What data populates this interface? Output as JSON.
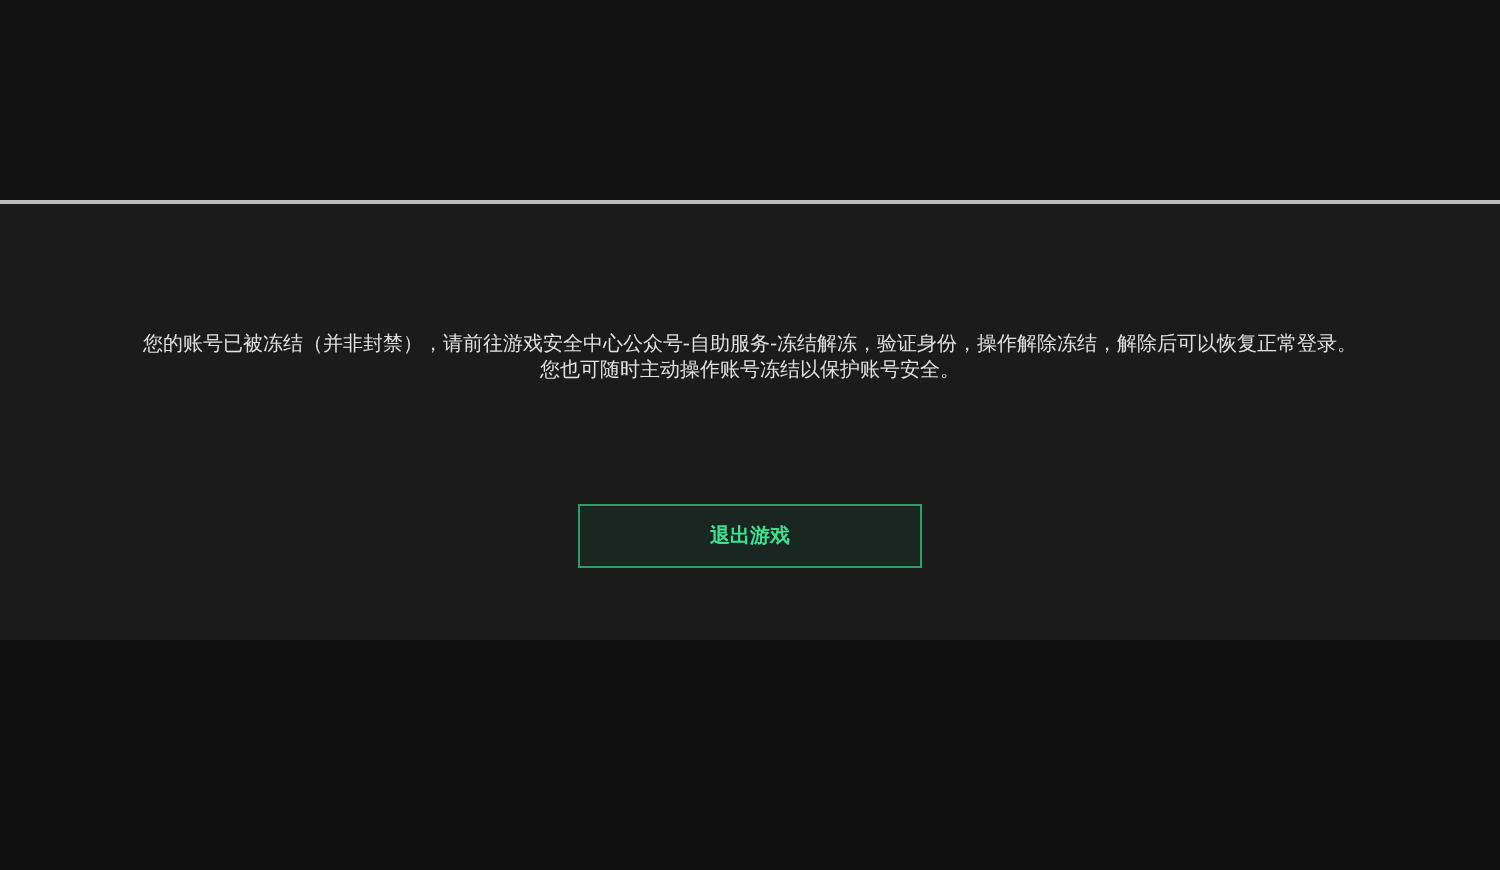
{
  "dialog": {
    "message_lines": [
      "您的账号已被冻结（并非封禁），请前往游戏安全中心公众号-自助服务-冻结解冻，验证身份，操作解除冻结，解除后可以恢复正常登录。",
      "您也可随时主动操作账号冻结以保护账号安全。"
    ],
    "button": "退出游戏"
  }
}
